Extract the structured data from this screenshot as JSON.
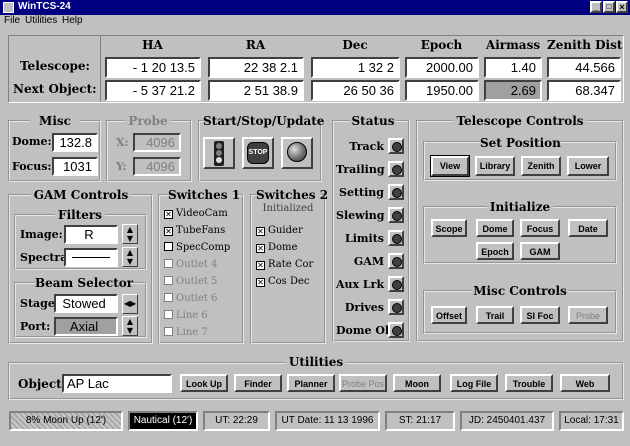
{
  "window": {
    "title": "WinTCS-24"
  },
  "menu": {
    "file": "File",
    "utilities": "Utilities",
    "help": "Help"
  },
  "coords": {
    "headers": {
      "ha": "HA",
      "ra": "RA",
      "dec": "Dec",
      "epoch": "Epoch",
      "airmass": "Airmass",
      "zenith": "Zenith Dist"
    },
    "telescope_label": "Telescope:",
    "next_label": "Next Object:",
    "telescope": {
      "ha": "- 1  20  13.5",
      "ra": "22  38   2.1",
      "dec": "1  32   2",
      "epoch": "2000.00",
      "airmass": "1.40",
      "zenith": "44.566"
    },
    "next": {
      "ha": "- 5  37  21.2",
      "ra": "2  51  38.9",
      "dec": "26  50  36",
      "epoch": "1950.00",
      "airmass": "2.69",
      "zenith": "68.347"
    }
  },
  "misc": {
    "title": "Misc",
    "dome_label": "Dome:",
    "dome": "132.8",
    "focus_label": "Focus:",
    "focus": "1031"
  },
  "probe": {
    "title": "Probe",
    "x_label": "X:",
    "x": "4096",
    "y_label": "Y:",
    "y": "4096"
  },
  "start_stop": {
    "title": "Start/Stop/Update",
    "stop_text": "STOP"
  },
  "status": {
    "title": "Status",
    "items": [
      "Track",
      "Trailing",
      "Setting",
      "Slewing",
      "Limits",
      "GAM",
      "Aux Lrk",
      "Drives",
      "Dome Ok"
    ]
  },
  "telescope_controls": {
    "title": "Telescope Controls",
    "set_position": {
      "title": "Set Position",
      "buttons": [
        "View",
        "Library",
        "Zenith",
        "Lower"
      ]
    },
    "initialize": {
      "title": "Initialize",
      "buttons": [
        "Scope",
        "Dome",
        "Focus",
        "Date",
        "Epoch",
        "GAM"
      ]
    },
    "misc_controls": {
      "title": "Misc Controls",
      "buttons": [
        "Offset",
        "Trail",
        "SI Foc",
        "Probe"
      ]
    }
  },
  "gam": {
    "title": "GAM Controls",
    "filters_title": "Filters",
    "image_label": "Image:",
    "image": "R",
    "spectral_label": "Spectral:",
    "spectral": "",
    "beam_title": "Beam Selector",
    "stage_label": "Stage:",
    "stage": "Stowed",
    "port_label": "Port:",
    "port": "Axial"
  },
  "switches1": {
    "title": "Switches 1",
    "items": [
      {
        "label": "VideoCam",
        "checked": true,
        "enabled": true
      },
      {
        "label": "TubeFans",
        "checked": true,
        "enabled": true
      },
      {
        "label": "SpecComp",
        "checked": false,
        "enabled": true
      },
      {
        "label": "Outlet 4",
        "checked": false,
        "enabled": false
      },
      {
        "label": "Outlet 5",
        "checked": false,
        "enabled": false
      },
      {
        "label": "Outlet 6",
        "checked": false,
        "enabled": false
      },
      {
        "label": "Line 6",
        "checked": false,
        "enabled": false
      },
      {
        "label": "Line 7",
        "checked": false,
        "enabled": false
      }
    ]
  },
  "switches2": {
    "title": "Switches 2",
    "subtitle": "Initialized",
    "items": [
      {
        "label": "Guider",
        "checked": true
      },
      {
        "label": "Dome",
        "checked": true
      },
      {
        "label": "Rate Cor",
        "checked": true
      },
      {
        "label": "Cos Dec",
        "checked": true
      }
    ]
  },
  "utilities": {
    "title": "Utilities",
    "object_label": "Object:",
    "object": "AP Lac",
    "buttons": [
      {
        "label": "Look Up",
        "enabled": true
      },
      {
        "label": "Finder",
        "enabled": true
      },
      {
        "label": "Planner",
        "enabled": true
      },
      {
        "label": "Probe Pos",
        "enabled": false
      },
      {
        "label": "Moon",
        "enabled": true
      },
      {
        "label": "Log File",
        "enabled": true
      },
      {
        "label": "Trouble",
        "enabled": true
      },
      {
        "label": "Web",
        "enabled": true
      }
    ]
  },
  "statusbar": {
    "moon": "8% Moon Up (12')",
    "twilight": "Nautical (12')",
    "ut": "UT: 22:29",
    "ut_date": "UT Date: 11 13 1996",
    "st": "ST: 21:17",
    "jd": "JD: 2450401.437",
    "local": "Local: 17:31"
  }
}
